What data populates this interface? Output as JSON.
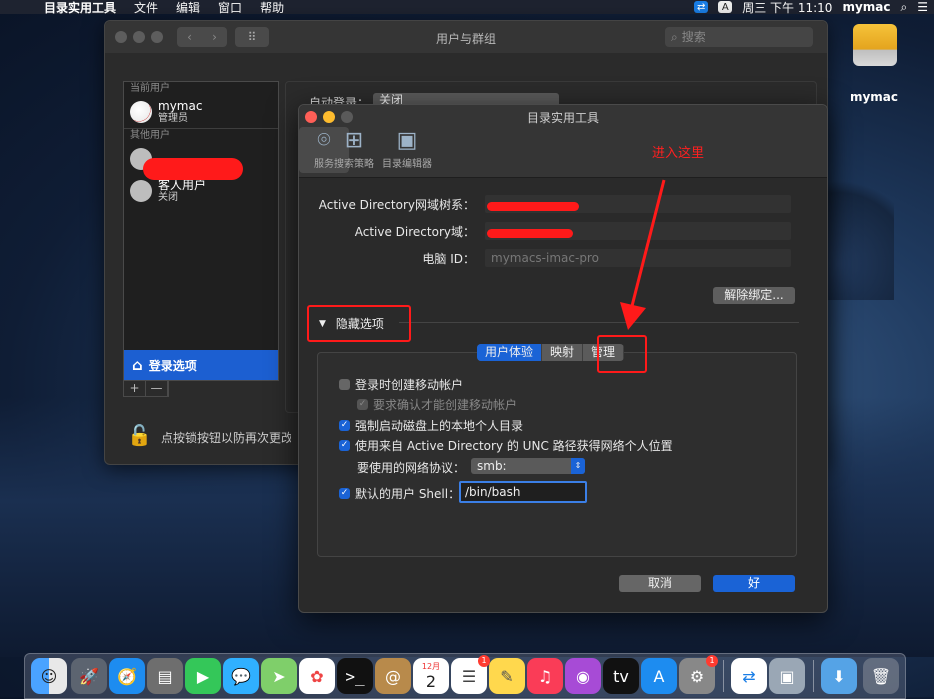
{
  "menubar": {
    "apple": "",
    "app_name": "目录实用工具",
    "menus": [
      "文件",
      "编辑",
      "窗口",
      "帮助"
    ],
    "datetime": "周三 下午 11:10",
    "user": "mymac",
    "input_method": "A"
  },
  "desktop": {
    "disk_label": "mymac"
  },
  "users_window": {
    "title": "用户与群组",
    "search_placeholder": "搜索",
    "current_users_header": "当前用户",
    "current_user": {
      "name": "mymac",
      "role": "管理员"
    },
    "other_users_header": "其他用户",
    "guest_user": {
      "name": "客人用户",
      "status": "关闭"
    },
    "login_options": "登录选项",
    "add": "+",
    "remove": "—",
    "lock_text": "点按锁按钮以防再次更改",
    "autologin_label": "自动登录：",
    "autologin_value": "关闭"
  },
  "dir_utility": {
    "title": "目录实用工具",
    "toolbar": [
      {
        "label": "服务",
        "icon": "services-icon"
      },
      {
        "label": "搜索策略",
        "icon": "search-policy-icon"
      },
      {
        "label": "目录编辑器",
        "icon": "directory-editor-icon"
      }
    ],
    "annotation": "进入这里",
    "forest_label": "Active Directory网域树系：",
    "domain_label": "Active Directory域：",
    "computer_id_label": "电脑 ID：",
    "computer_id_value": "mymacs-imac-pro",
    "unbind_button": "解除绑定...",
    "hidden_options": "隐藏选项",
    "tabs": [
      "用户体验",
      "映射",
      "管理"
    ],
    "selected_tab": "用户体验",
    "create_mobile_account": "登录时创建移动帐户",
    "require_confirmation": "要求确认才能创建移动帐户",
    "force_local_home": "强制启动磁盘上的本地个人目录",
    "use_unc_path": "使用来自 Active Directory 的 UNC 路径获得网络个人位置",
    "protocol_label": "要使用的网络协议：",
    "protocol_value": "smb:",
    "default_shell_label": "默认的用户 Shell：",
    "default_shell_value": "/bin/bash",
    "cancel": "取消",
    "ok": "好"
  },
  "dock": {
    "apps": [
      "Finder",
      "Launchpad",
      "Safari",
      "Photo Booth",
      "FaceTime",
      "Messages",
      "Maps",
      "Photos",
      "Terminal",
      "Contacts",
      "Calendar",
      "Reminders",
      "Notes",
      "Music",
      "Podcasts",
      "TV",
      "App Store",
      "System Preferences",
      "TeamViewer",
      "Directory Utility",
      "Downloads",
      "Trash"
    ],
    "calendar_month": "12月",
    "calendar_day": "2",
    "reminders_badge": "1",
    "sysprefs_badge": "1"
  }
}
